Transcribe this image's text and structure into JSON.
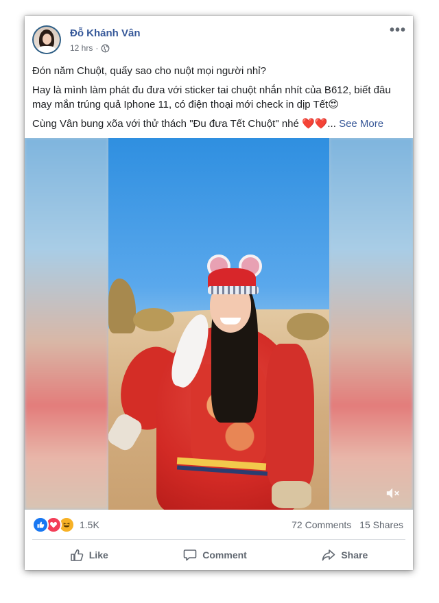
{
  "post": {
    "author": "Đỗ Khánh Vân",
    "time": "12 hrs",
    "separator": "·",
    "more": "•••",
    "text": {
      "line1": "Đón năm Chuột, quẩy sao cho nuột mọi người nhỉ?",
      "line2": "Hay là mình làm phát đu đưa với sticker tai chuột nhắn nhít của B612, biết đâu may mắn trúng quả Iphone 11, có điện thoại mới check in dịp Tết😍",
      "line3": "Cùng Vân bung xõa với thử thách \"Đu đưa Tết Chuột\" nhé ❤️❤️...",
      "see_more": "See More"
    }
  },
  "reactions": {
    "like_icon": "like-icon",
    "love_icon": "love-icon",
    "haha_icon": "haha-icon",
    "count": "1.5K"
  },
  "stats": {
    "comments": "72 Comments",
    "shares": "15 Shares"
  },
  "actions": {
    "like": "Like",
    "comment": "Comment",
    "share": "Share"
  },
  "colors": {
    "author_link": "#365899",
    "see_more": "#385898",
    "like_blue": "#1877f2",
    "love_red": "#f33e58",
    "haha_yellow": "#f7b125"
  }
}
